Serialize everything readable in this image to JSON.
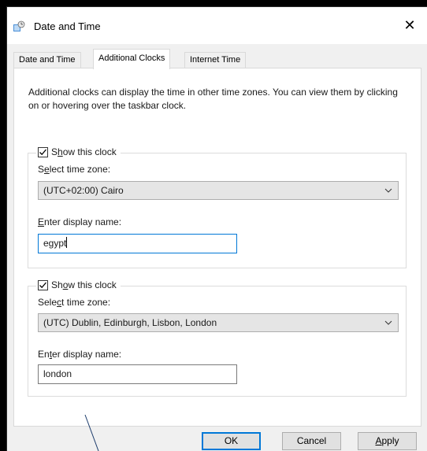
{
  "window": {
    "title": "Date and Time",
    "close_glyph": "✕",
    "icon": "clock-globe-icon"
  },
  "tabs": [
    {
      "label": "Date and Time",
      "active": false
    },
    {
      "label": "Additional Clocks",
      "active": true
    },
    {
      "label": "Internet Time",
      "active": false
    }
  ],
  "intro_text": "Additional clocks can display the time in other time zones. You can view them by clicking on or hovering over the taskbar clock.",
  "clocks": [
    {
      "show_label_pre": "S",
      "show_label_u": "h",
      "show_label_post": "ow this clock",
      "checked": true,
      "tz_label_pre": "S",
      "tz_label_u": "e",
      "tz_label_post": "lect time zone:",
      "timezone": "(UTC+02:00) Cairo",
      "name_label_pre": "",
      "name_label_u": "E",
      "name_label_post": "nter display name:",
      "display_name": "egypt"
    },
    {
      "show_label_pre": "Sh",
      "show_label_u": "o",
      "show_label_post": "w this clock",
      "checked": true,
      "tz_label_pre": "Sele",
      "tz_label_u": "c",
      "tz_label_post": "t time zone:",
      "timezone": "(UTC) Dublin, Edinburgh, Lisbon, London",
      "name_label_pre": "En",
      "name_label_u": "t",
      "name_label_post": "er display name:",
      "display_name": "london"
    }
  ],
  "buttons": {
    "ok": "OK",
    "cancel": "Cancel",
    "apply_u": "A",
    "apply_post": "pply"
  },
  "colors": {
    "accent": "#0078d7",
    "window_bg": "#f0f0f0",
    "panel_bg": "#ffffff"
  }
}
